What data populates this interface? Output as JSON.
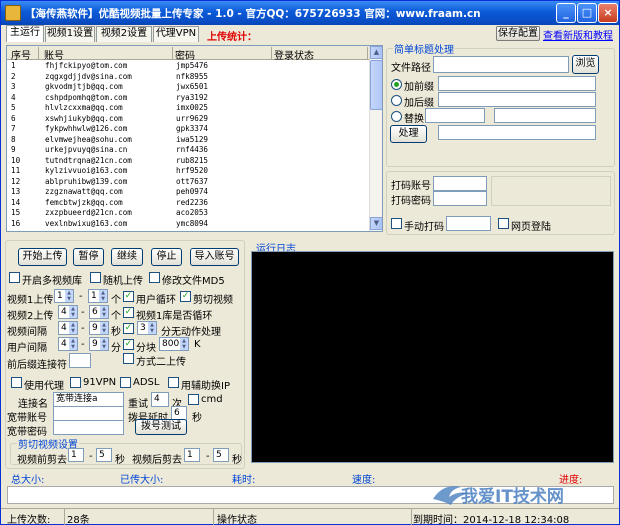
{
  "window": {
    "title": "【海传燕软件】优酷视频批量上传专家 - 1.0 - 官方QQ：675726933  官网：www.fraam.cn",
    "min": "_",
    "max": "□",
    "close": "×"
  },
  "tabs": [
    "主运行",
    "视频1设置",
    "视频2设置",
    "代理VPN"
  ],
  "upload_stats_label": "上传统计：",
  "save_config": "保存配置",
  "check_update": "查看新版和教程",
  "table": {
    "headers": [
      "序号",
      "账号",
      "密码",
      "登录状态"
    ],
    "rows": [
      [
        "1",
        "fhjfckipyo@tom.com",
        "jmp5476",
        ""
      ],
      [
        "2",
        "zqgxgdjjdv@sina.com",
        "nfk8955",
        ""
      ],
      [
        "3",
        "gkvodmjtjb@qq.com",
        "jwx6501",
        ""
      ],
      [
        "4",
        "cshpdpomhq@tom.com",
        "rya3192",
        ""
      ],
      [
        "5",
        "hlvlzcxxma@qq.com",
        "imx0025",
        ""
      ],
      [
        "6",
        "xswhjiukyb@qq.com",
        "urr9629",
        ""
      ],
      [
        "7",
        "fykpwhhwlw@126.com",
        "gpk3374",
        ""
      ],
      [
        "8",
        "elvmwejhea@sohu.com",
        "iwa5129",
        ""
      ],
      [
        "9",
        "urkejpvuyq@sina.cn",
        "rnf4436",
        ""
      ],
      [
        "10",
        "tutndtrqna@21cn.com",
        "rub8215",
        ""
      ],
      [
        "11",
        "kylzivvuoi@163.com",
        "hrf9520",
        ""
      ],
      [
        "12",
        "ablpruhibw@139.com",
        "ott7637",
        ""
      ],
      [
        "13",
        "zzgznawatt@qq.com",
        "peh0974",
        ""
      ],
      [
        "14",
        "femcbtwjzk@qq.com",
        "red2236",
        ""
      ],
      [
        "15",
        "zxzpbueerd@21cn.com",
        "aco2053",
        ""
      ],
      [
        "16",
        "vexlnbwixu@163.com",
        "ymc8094",
        ""
      ]
    ]
  },
  "title_proc": {
    "legend": "简单标题处理",
    "file_path": "文件路径",
    "browse": "浏览",
    "prefix": "加前缀",
    "suffix": "加后缀",
    "replace": "替换",
    "process": "处理"
  },
  "captcha": {
    "account": "打码账号",
    "password": "打码密码",
    "manual": "手动打码",
    "web_login": "网页登陆"
  },
  "buttons": {
    "start": "开始上传",
    "pause": "暂停",
    "resume": "继续",
    "stop": "停止",
    "import": "导入账号"
  },
  "options": {
    "multi_lib": "开启多视频库",
    "random": "随机上传",
    "md5": "修改文件MD5",
    "v1_upload": "视频1上传",
    "v1_from": "1",
    "v1_to": "1",
    "unit_ge": "个",
    "user_loop": "用户循环",
    "cut_video": "剪切视频",
    "v2_upload": "视频2上传",
    "v2_from": "4",
    "v2_to": "6",
    "v1_lib_loop": "视频1库是否循环",
    "video_interval": "视频间隔",
    "vi_from": "4",
    "vi_to": "9",
    "unit_sec": "秒",
    "no_action_val": "3",
    "no_action": "分无动作处理",
    "user_interval": "用户间隔",
    "ui_from": "4",
    "ui_to": "9",
    "unit_min": "分",
    "chunk": "分块",
    "chunk_val": "800",
    "chunk_unit": "K",
    "prefix_connector": "前后缀连接符",
    "mode2": "方式二上传"
  },
  "network": {
    "use_proxy": "使用代理",
    "vpn91": "91VPN",
    "adsl": "ADSL",
    "auxip": "用辅助换IP",
    "conn_name": "连接名",
    "conn_value": "宽带连接a",
    "retry": "重试",
    "retry_val": "4",
    "retry_unit": "次",
    "cmd": "cmd",
    "bb_account": "宽带账号",
    "dial_delay": "拨号延时",
    "dial_delay_val": "6",
    "dial_delay_unit": "秒",
    "bb_password": "宽带密码",
    "dial_test": "拨号测试"
  },
  "cut": {
    "legend": "剪切视频设置",
    "front": "视频前剪去",
    "front_from": "1",
    "front_to": "5",
    "back": "视频后剪去",
    "back_from": "1",
    "back_to": "5",
    "unit": "秒",
    "dash": "-"
  },
  "log_label": "运行日志",
  "progress": {
    "total": "总大小:",
    "uploaded": "已传大小:",
    "elapsed": "耗时:",
    "speed": "速度:",
    "progress": "进度:"
  },
  "statusbar": {
    "upload_count": "上传次数:",
    "count": "28条",
    "op_state": "操作状态",
    "expiry": "到期时间：2014-12-18 12:34:08"
  },
  "watermark": "我爱IT技术网"
}
